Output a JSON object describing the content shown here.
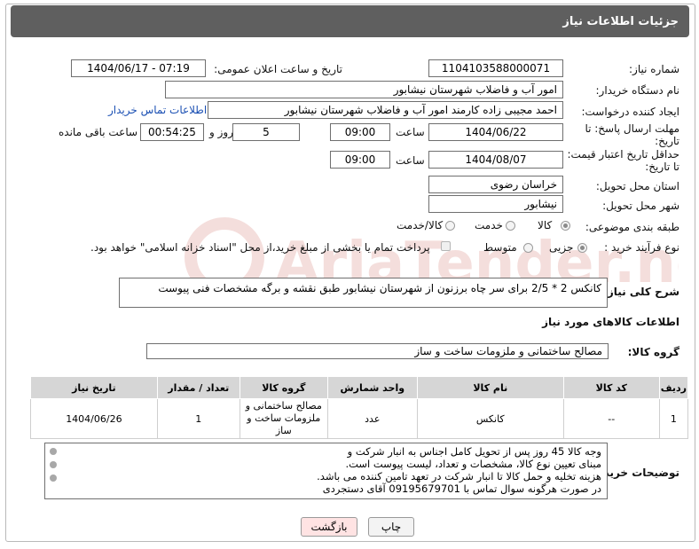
{
  "header": {
    "title": "جزئیات اطلاعات نیاز"
  },
  "fields": {
    "need_number_label": "شماره نیاز:",
    "need_number": "1104103588000071",
    "announce_label": "تاریخ و ساعت اعلان عمومی:",
    "announce_value": "1404/06/17 - 07:19",
    "buyer_org_label": "نام دستگاه خریدار:",
    "buyer_org": "امور آب و فاضلاب شهرستان نیشابور",
    "creator_label": "ایجاد کننده درخواست:",
    "creator": "احمد مجیبی زاده کارمند امور آب و فاضلاب شهرستان نیشابور",
    "buyer_contact_link": "اطلاعات تماس خریدار",
    "deadline_label_1": "مهلت ارسال پاسخ: تا",
    "deadline_label_2": "تاریخ:",
    "deadline_date": "1404/06/22",
    "time_label": "ساعت",
    "deadline_time": "09:00",
    "days_value": "5",
    "days_label": "روز و",
    "remaining_time": "00:54:25",
    "remaining_label": "ساعت باقی مانده",
    "validity_label_1": "حداقل تاریخ اعتبار قیمت:",
    "validity_label_2": "تا تاریخ:",
    "validity_date": "1404/08/07",
    "validity_time": "09:00",
    "province_label": "استان محل تحویل:",
    "province": "خراسان رضوی",
    "city_label": "شهر محل تحویل:",
    "city": "نیشابور",
    "category_label": "طبقه بندی موضوعی:",
    "category_options": [
      "کالا",
      "خدمت",
      "کالا/خدمت"
    ],
    "purchase_type_label": "نوع فرآیند خرید :",
    "purchase_options": [
      "جزیی",
      "متوسط"
    ],
    "payment_note": "پرداخت تمام یا بخشی از مبلغ خرید،از محل \"اسناد خزانه اسلامی\" خواهد بود.",
    "description_label": "شرح کلی نیاز:",
    "description": "کانکس 2 * 2/5 برای سر چاه برزنون از شهرستان نیشابور طبق نقشه و برگه مشخصات فنی پیوست",
    "goods_info_title": "اطلاعات کالاهای مورد نیاز",
    "goods_group_label": "گروه کالا:",
    "goods_group": "مصالح ساختمانی و ملزومات ساخت و ساز"
  },
  "table": {
    "headers": [
      "ردیف",
      "کد کالا",
      "نام کالا",
      "واحد شمارش",
      "گروه کالا",
      "تعداد / مقدار",
      "تاریخ نیاز"
    ],
    "rows": [
      [
        "1",
        "--",
        "کانکس",
        "عدد",
        "مصالح ساختمانی و ملزومات ساخت و ساز",
        "1",
        "1404/06/26"
      ]
    ]
  },
  "buyer_notes": {
    "label": "توضیحات خریدار:",
    "lines": [
      "وجه کالا 45 روز پس از تحویل کامل اجناس به انبار شرکت و",
      "مبنای تعیین نوع کالا، مشخصات و تعداد، لیست پیوست است.",
      "هزینه تخلیه و حمل کالا تا انبار شرکت در تعهد تامین کننده می باشد.",
      "در صورت هرگونه سوال تماس با 09195679701 آقای دستجردی"
    ]
  },
  "buttons": {
    "print": "چاپ",
    "back": "بازگشت"
  },
  "watermark": "AriaTender.neT",
  "colors": {
    "header_bg": "#5f5f5f",
    "link": "#1a4fb3",
    "back_btn_bg": "#ffe3e3",
    "watermark": "#c0392b"
  }
}
